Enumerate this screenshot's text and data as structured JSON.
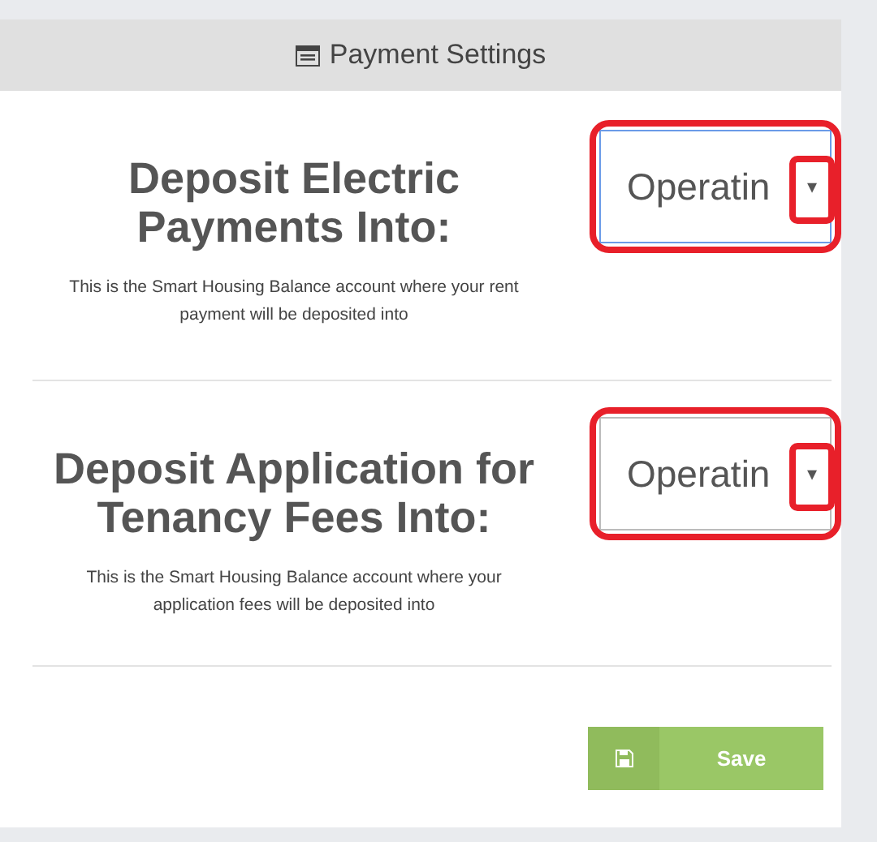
{
  "header": {
    "title": "Payment Settings"
  },
  "settings": [
    {
      "heading": "Deposit Electric Payments Into:",
      "description": "This is the Smart Housing Balance account where your rent payment will be deposited into",
      "select": {
        "value": "Operatin",
        "arrow": "▾",
        "focused": true
      },
      "highlighted": true
    },
    {
      "heading": "Deposit Application for Tenancy Fees Into:",
      "description": "This is the Smart Housing Balance account where your application fees will be deposited into",
      "select": {
        "value": "Operatin",
        "arrow": "▾",
        "focused": false
      },
      "highlighted": true
    }
  ],
  "save_button": {
    "label": "Save"
  }
}
